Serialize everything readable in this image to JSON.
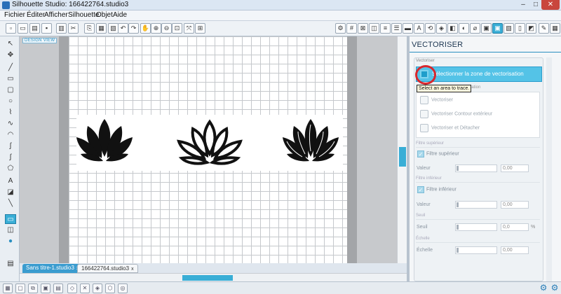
{
  "window": {
    "title": "Silhouette Studio: 166422764.studio3",
    "min_glyph": "–",
    "max_glyph": "□",
    "close_glyph": "✕"
  },
  "menu": [
    "Fichier",
    "Éditer",
    "Afficher",
    "Silhouette",
    "Objet",
    "Aide"
  ],
  "canvas": {
    "design_view_label": "DESIGN VIEW"
  },
  "tabs": [
    {
      "label": "Sans titre-1.studio3",
      "close": "x"
    },
    {
      "label": "166422764.studio3",
      "close": "x"
    }
  ],
  "panel": {
    "title": "VECTORISER",
    "section_label": "Vectoriser",
    "select_button_label": "Sélectionner la zone de vectorisation",
    "tooltip": "Select an area to trace.",
    "hidden_header_fragment": "torisation",
    "actions": [
      {
        "label": "Vectoriser",
        "icon": "trace-icon"
      },
      {
        "label": "Vectoriser Contour extérieur",
        "icon": "trace-outer-icon"
      },
      {
        "label": "Vectoriser et Détacher",
        "icon": "trace-detach-icon"
      }
    ],
    "high_pass": {
      "section_label": "Filtre supérieur",
      "checkbox_label": "Filtre supérieur",
      "value_label": "Valeur",
      "value": "0,00",
      "checked": true
    },
    "low_pass": {
      "section_label": "Filtre inférieur",
      "checkbox_label": "Filtre inférieur",
      "value_label": "Valeur",
      "value": "0,00",
      "checked": true
    },
    "threshold": {
      "section_label": "Seuil",
      "value_label": "Seuil",
      "value": "0,0",
      "unit": "%"
    },
    "scale": {
      "section_label": "Échelle",
      "value_label": "Échelle",
      "value": "0,00"
    }
  },
  "colors": {
    "accent": "#39aed6",
    "selection_ring": "#d8262c",
    "lotus_fill": "#111111"
  }
}
